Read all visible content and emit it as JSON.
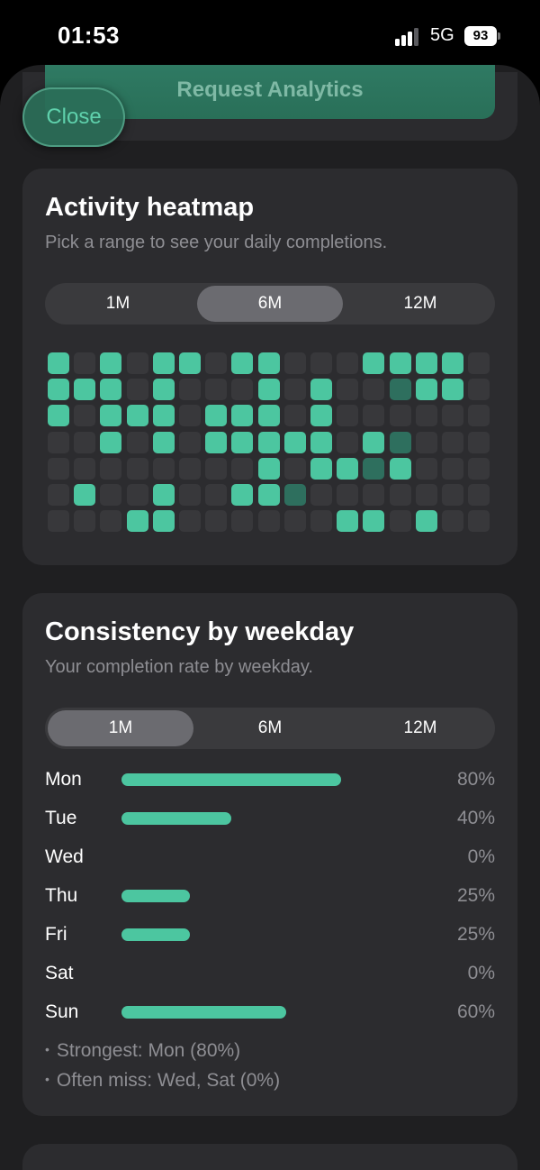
{
  "status_bar": {
    "time": "01:53",
    "network": "5G",
    "battery": "93"
  },
  "header": {
    "request_label": "Request Analytics",
    "close_label": "Close"
  },
  "heatmap": {
    "title": "Activity heatmap",
    "subtitle": "Pick a range to see your daily completions.",
    "ranges": [
      "1M",
      "6M",
      "12M"
    ],
    "selected_range": "6M",
    "colors": {
      "full": "#4cc6a0",
      "partial": "#2e6f5e",
      "empty": "#38383b"
    },
    "grid": [
      [
        2,
        0,
        2,
        0,
        2,
        2,
        0,
        2,
        2,
        0,
        0,
        0,
        2,
        2,
        2,
        2,
        0
      ],
      [
        2,
        2,
        2,
        0,
        2,
        0,
        0,
        0,
        2,
        0,
        2,
        0,
        0,
        1,
        2,
        2,
        0
      ],
      [
        2,
        0,
        2,
        2,
        2,
        0,
        2,
        2,
        2,
        0,
        2,
        0,
        0,
        0,
        0,
        0,
        0
      ],
      [
        0,
        0,
        2,
        0,
        2,
        0,
        2,
        2,
        2,
        2,
        2,
        0,
        2,
        1,
        0,
        0,
        0
      ],
      [
        0,
        0,
        0,
        0,
        0,
        0,
        0,
        0,
        2,
        0,
        2,
        2,
        1,
        2,
        0,
        0,
        0
      ],
      [
        0,
        2,
        0,
        0,
        2,
        0,
        0,
        2,
        2,
        1,
        0,
        0,
        0,
        0,
        0,
        0,
        0
      ],
      [
        0,
        0,
        0,
        2,
        2,
        0,
        0,
        0,
        0,
        0,
        0,
        2,
        2,
        0,
        2,
        0,
        0
      ]
    ]
  },
  "weekday": {
    "title": "Consistency by weekday",
    "subtitle": "Your completion rate by weekday.",
    "ranges": [
      "1M",
      "6M",
      "12M"
    ],
    "selected_range": "1M",
    "accent": "#4cc6a0",
    "rows": [
      {
        "day": "Mon",
        "percent": 80,
        "label": "80%"
      },
      {
        "day": "Tue",
        "percent": 40,
        "label": "40%"
      },
      {
        "day": "Wed",
        "percent": 0,
        "label": "0%"
      },
      {
        "day": "Thu",
        "percent": 25,
        "label": "25%"
      },
      {
        "day": "Fri",
        "percent": 25,
        "label": "25%"
      },
      {
        "day": "Sat",
        "percent": 0,
        "label": "0%"
      },
      {
        "day": "Sun",
        "percent": 60,
        "label": "60%"
      }
    ],
    "notes": [
      "Strongest: Mon (80%)",
      "Often miss: Wed, Sat (0%)"
    ]
  }
}
